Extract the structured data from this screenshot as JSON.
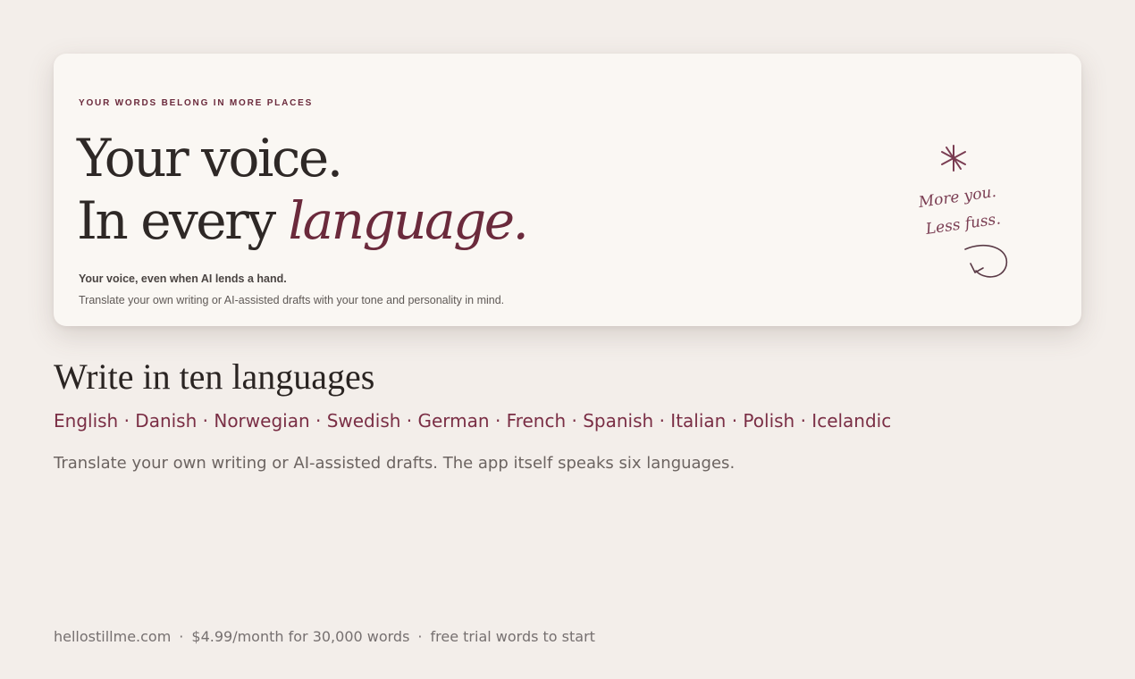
{
  "hero": {
    "eyebrow": "YOUR WORDS BELONG IN MORE PLACES",
    "headline_line1": "Your voice.",
    "headline_line2_plain": "In every ",
    "headline_line2_accent": "language.",
    "subhead": "Your voice, even when AI lends a hand.",
    "subtext": "Translate your own writing or AI-assisted drafts with your tone and personality in mind.",
    "doodle": {
      "line1": "More you.",
      "line2": "Less fuss.",
      "icons": [
        "asterisk-icon",
        "curved-arrow-icon"
      ]
    }
  },
  "section": {
    "title": "Write in ten languages",
    "separator": "·",
    "languages": [
      "English",
      "Danish",
      "Norwegian",
      "Swedish",
      "German",
      "French",
      "Spanish",
      "Italian",
      "Polish",
      "Icelandic"
    ],
    "description": "Translate your own writing or AI-assisted drafts. The app itself speaks six languages."
  },
  "footer": {
    "separator": "·",
    "domain": "hellostillme.com",
    "price": "$4.99/month for 30,000 words",
    "trial": "free trial words to start"
  },
  "colors": {
    "background": "#f3eeea",
    "card": "#faf7f3",
    "accent": "#6b2a3c",
    "text_dark": "#2e2826",
    "text_muted": "#6c6461"
  }
}
